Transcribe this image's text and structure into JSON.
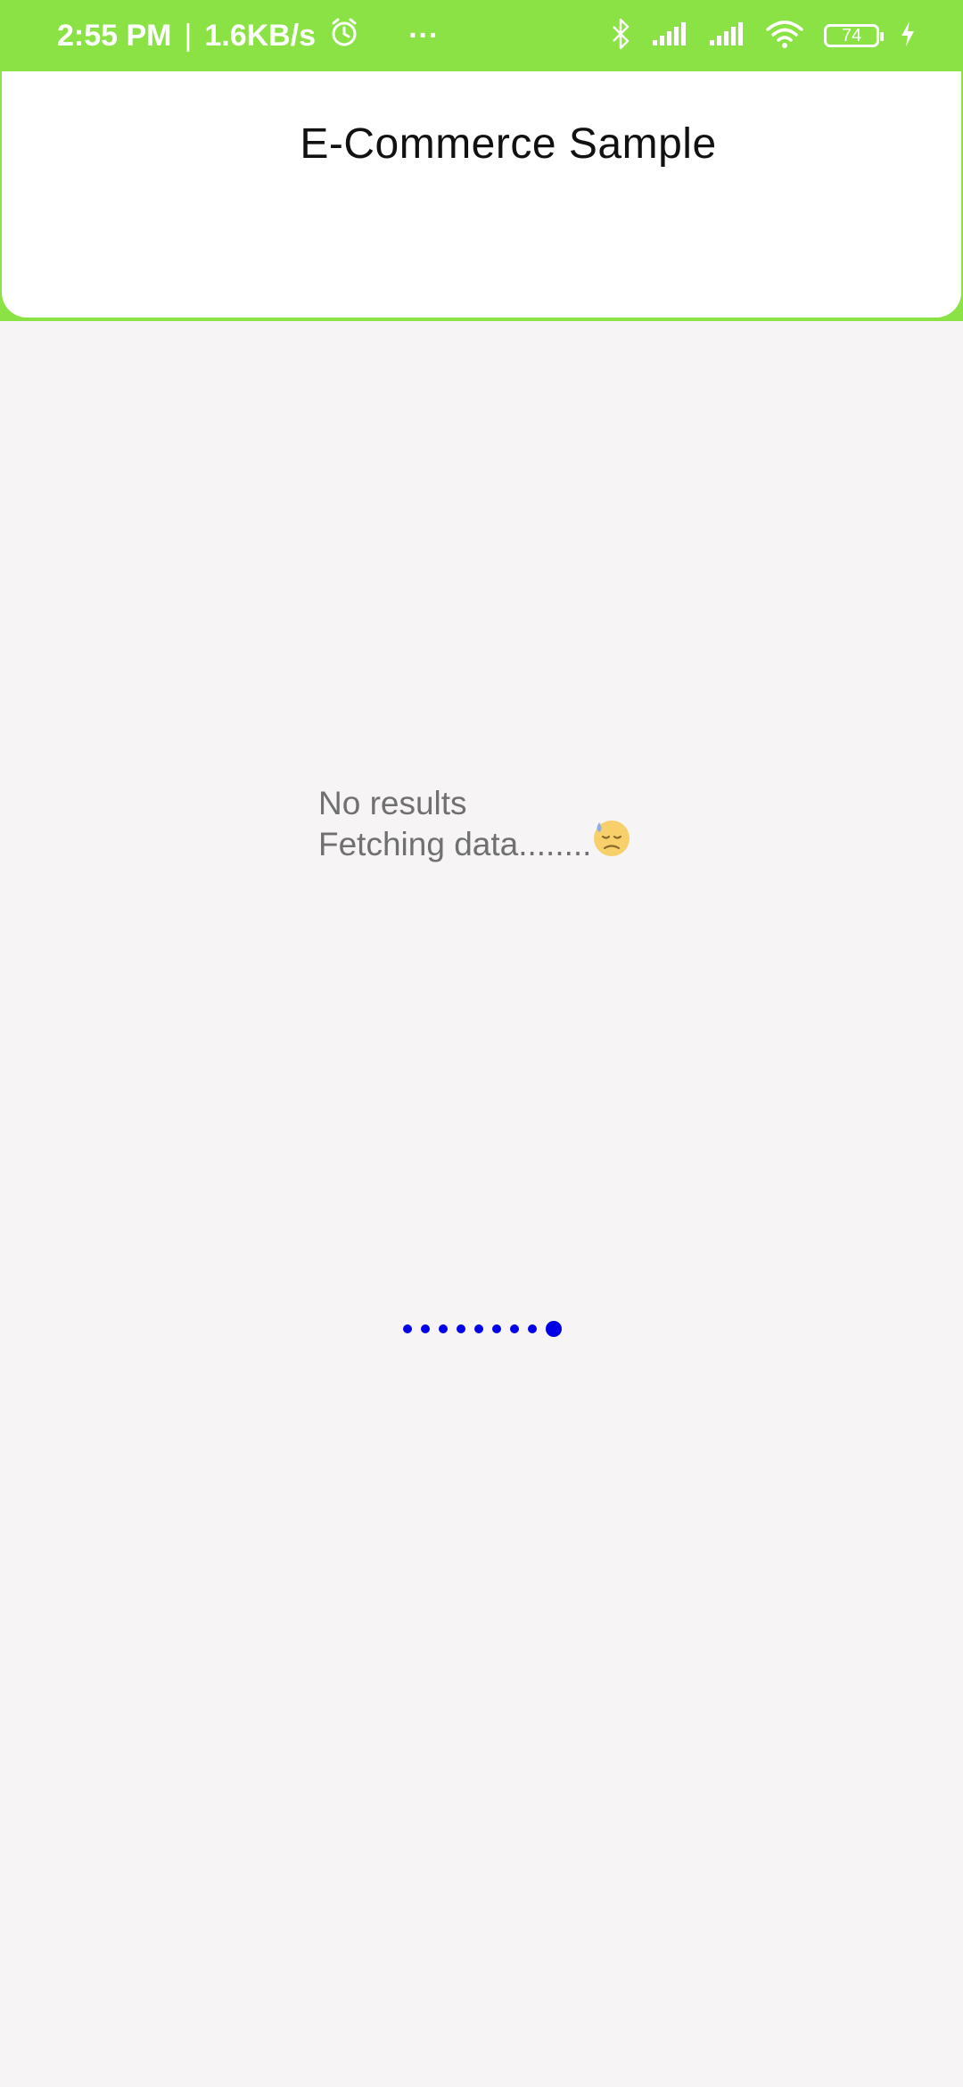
{
  "status_bar": {
    "time": "2:55 PM",
    "separator": "|",
    "network_speed": "1.6KB/s",
    "overflow": "···",
    "battery_level": "74",
    "icons": [
      "alarm-icon",
      "bluetooth-icon",
      "signal-icon",
      "signal-icon",
      "wifi-icon",
      "battery-icon",
      "charging-icon"
    ]
  },
  "header": {
    "title": "E-Commerce Sample"
  },
  "empty_state": {
    "line1": "No results",
    "line2": "Fetching data........"
  },
  "loader": {
    "dot_count": 9,
    "active_index": 8
  },
  "colors": {
    "accent": "#8ae244",
    "background": "#f6f4f5",
    "loader": "#0000e6",
    "muted_text": "#707070"
  }
}
